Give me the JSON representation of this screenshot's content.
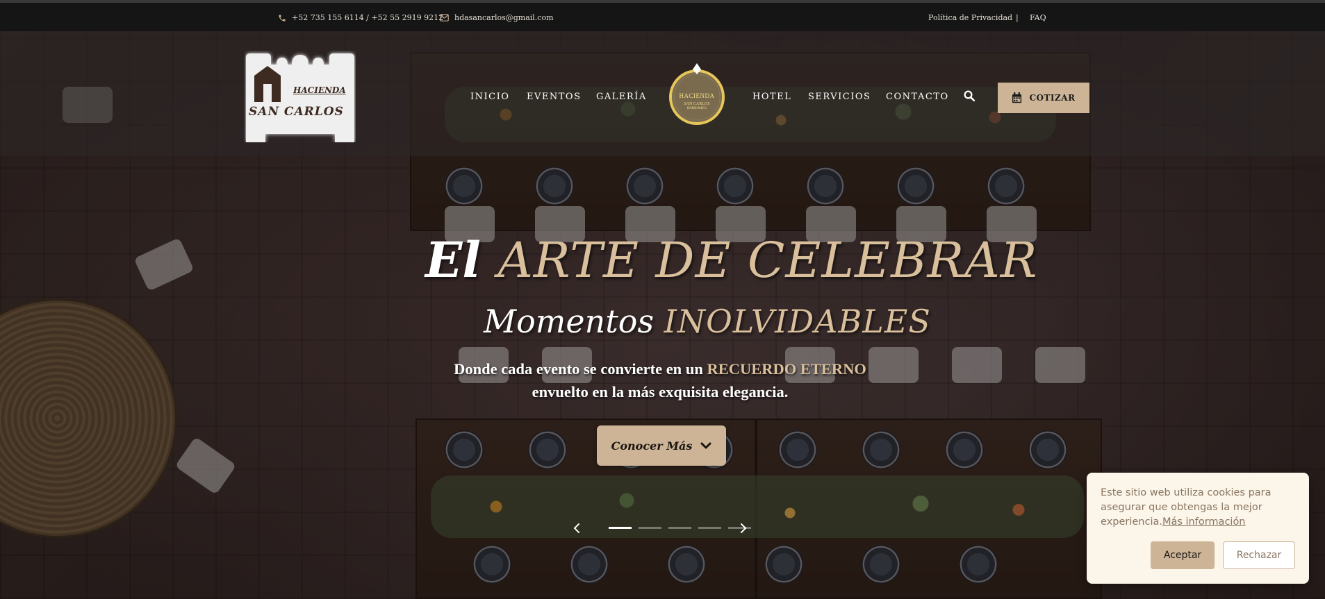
{
  "topbar": {
    "phone": "+52 735 155 6114 / +52 55 2919 9212",
    "email": "hdasancarlos@gmail.com",
    "privacy": "Política de Privacidad",
    "separator": "|",
    "faq": "FAQ"
  },
  "logo": {
    "line1": "HACIENDA",
    "line2": "SAN CARLOS"
  },
  "center_logo": {
    "line1": "HACIENDA",
    "line2": "SAN CARLOS",
    "line3": "BORROMEO"
  },
  "nav": {
    "inicio": "INICIO",
    "eventos": "EVENTOS",
    "galeria": "GALERÍA",
    "hotel": "HOTEL",
    "servicios": "SERVICIOS",
    "contacto": "CONTACTO"
  },
  "cotizar_label": "COTIZAR",
  "hero": {
    "line1_a": "El ",
    "line1_b": "ARTE DE CELEBRAR",
    "line2_a": "Momentos ",
    "line2_b": "INOLVIDABLES",
    "tagline_a": "Donde cada evento se convierte en un ",
    "tagline_highlight": "RECUERDO ETERNO",
    "tagline_b": "envuelto en la más exquisita elegancia.",
    "cta_label": "Conocer Más"
  },
  "slider": {
    "slide_count": 5,
    "active_index": 0
  },
  "cookie": {
    "text": "Este sitio web utiliza cookies para asegurar que obtengas la mejor experiencia.",
    "link": "Más información",
    "accept": "Aceptar",
    "reject": "Rechazar"
  },
  "colors": {
    "accent": "#cdb497",
    "gold_text": "#d9bf9c",
    "topbar_bg": "#151515",
    "cookie_bg": "#fbf5ea",
    "cookie_text": "#8a7660"
  },
  "icons": [
    "phone-icon",
    "mail-icon",
    "search-icon",
    "calendar-icon",
    "chevron-down-icon",
    "chevron-left-icon",
    "chevron-right-icon"
  ]
}
